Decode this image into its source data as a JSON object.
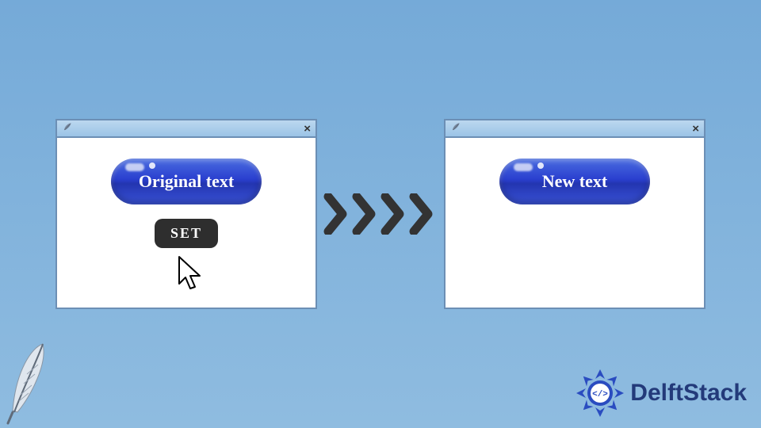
{
  "left_window": {
    "pill_label": "Original text",
    "set_button_label": "SET"
  },
  "right_window": {
    "pill_label": "New text"
  },
  "brand": {
    "name": "DelftStack"
  },
  "colors": {
    "bg_top": "#75aad8",
    "bg_bottom": "#8fbce0",
    "pill_blue": "#2a3fcf",
    "brand_blue": "#233a7a"
  }
}
